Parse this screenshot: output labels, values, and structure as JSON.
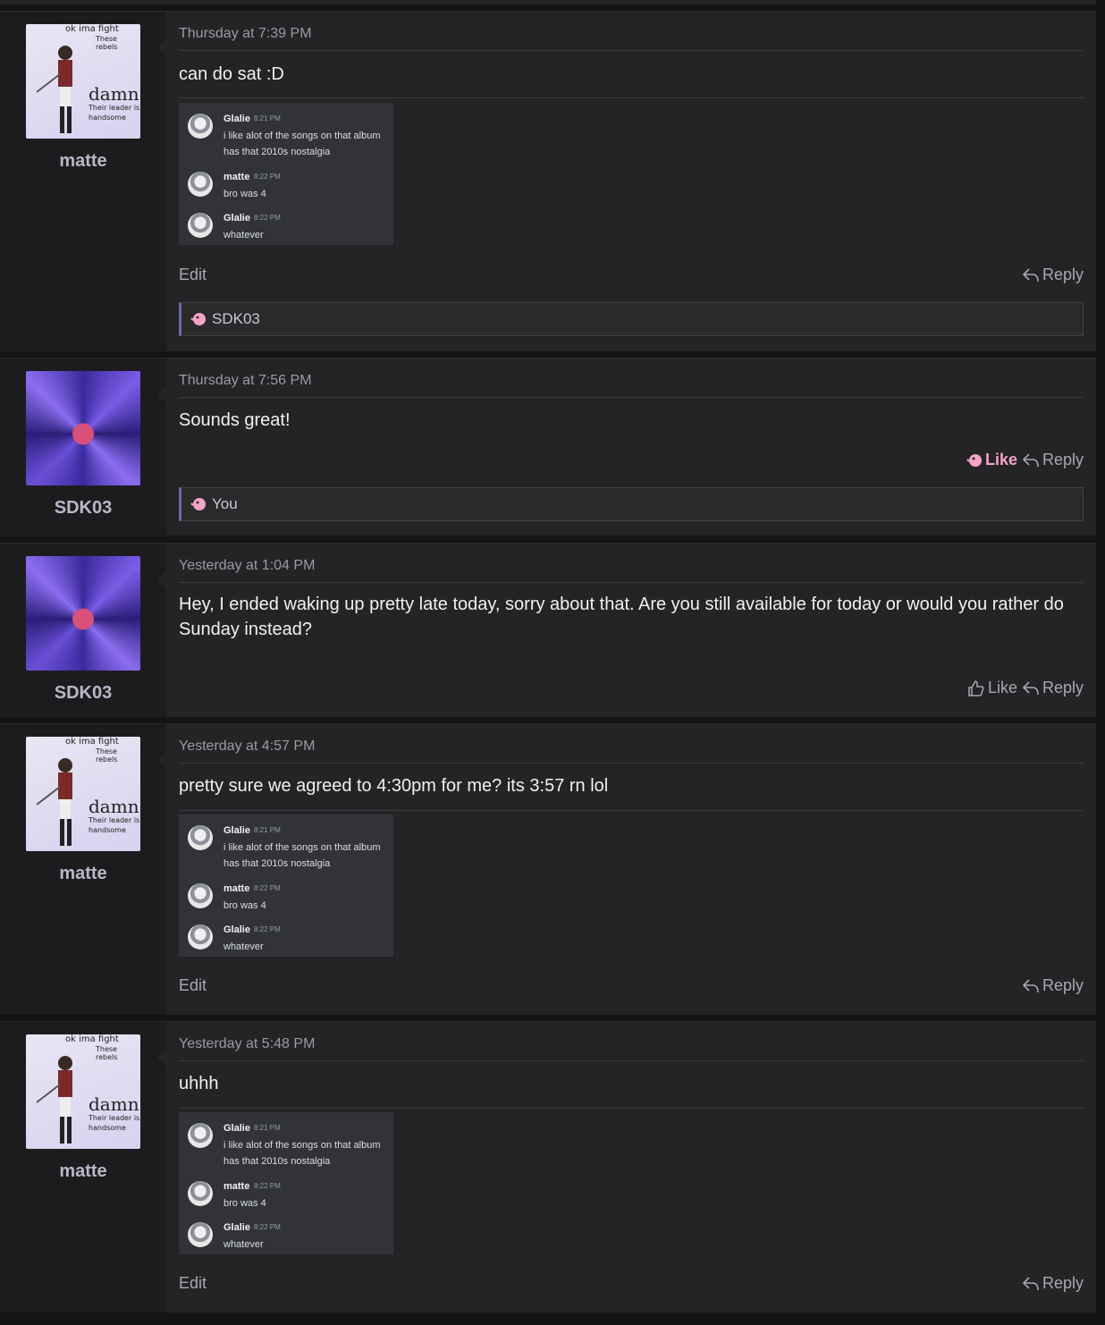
{
  "posts": [
    {
      "username": "matte",
      "avatar_text": {
        "l1": "ok ima fight",
        "l2": "These rebels",
        "l3": "damn",
        "l4": "Their leader is",
        "l5": "handsome"
      },
      "timestamp": "Thursday at 7:39 PM",
      "message": "can do sat :D",
      "embed": [
        {
          "name": "Glalie",
          "time": "8:21 PM",
          "text": "i like alot of the songs on that album has that 2010s nostalgia"
        },
        {
          "name": "matte",
          "time": "8:22 PM",
          "text": "bro was 4"
        },
        {
          "name": "Glalie",
          "time": "8:22 PM",
          "text": "whatever"
        }
      ],
      "edit_label": "Edit",
      "reply_label": "Reply",
      "likes_text": "SDK03"
    },
    {
      "username": "SDK03",
      "timestamp": "Thursday at 7:56 PM",
      "message": "Sounds great!",
      "like_label": "Like",
      "reply_label": "Reply",
      "likes_text": "You"
    },
    {
      "username": "SDK03",
      "timestamp": "Yesterday at 1:04 PM",
      "message": "Hey, I ended waking up pretty late today, sorry about that. Are you still available for today or would you rather do Sunday instead?",
      "like_label": "Like",
      "reply_label": "Reply"
    },
    {
      "username": "matte",
      "avatar_text": {
        "l1": "ok ima fight",
        "l2": "These rebels",
        "l3": "damn",
        "l4": "Their leader is",
        "l5": "handsome"
      },
      "timestamp": "Yesterday at 4:57 PM",
      "message": "pretty sure we agreed to 4:30pm for me? its 3:57 rn lol",
      "embed": [
        {
          "name": "Glalie",
          "time": "8:21 PM",
          "text": "i like alot of the songs on that album has that 2010s nostalgia"
        },
        {
          "name": "matte",
          "time": "8:22 PM",
          "text": "bro was 4"
        },
        {
          "name": "Glalie",
          "time": "8:22 PM",
          "text": "whatever"
        }
      ],
      "edit_label": "Edit",
      "reply_label": "Reply"
    },
    {
      "username": "matte",
      "avatar_text": {
        "l1": "ok ima fight",
        "l2": "These rebels",
        "l3": "damn",
        "l4": "Their leader is",
        "l5": "handsome"
      },
      "timestamp": "Yesterday at 5:48 PM",
      "message": "uhhh",
      "embed": [
        {
          "name": "Glalie",
          "time": "8:21 PM",
          "text": "i like alot of the songs on that album has that 2010s nostalgia"
        },
        {
          "name": "matte",
          "time": "8:22 PM",
          "text": "bro was 4"
        },
        {
          "name": "Glalie",
          "time": "8:22 PM",
          "text": "whatever"
        }
      ],
      "edit_label": "Edit",
      "reply_label": "Reply"
    }
  ],
  "colors": {
    "liked": "#f5a3c7",
    "accent_bar": "#6d6aa8"
  }
}
